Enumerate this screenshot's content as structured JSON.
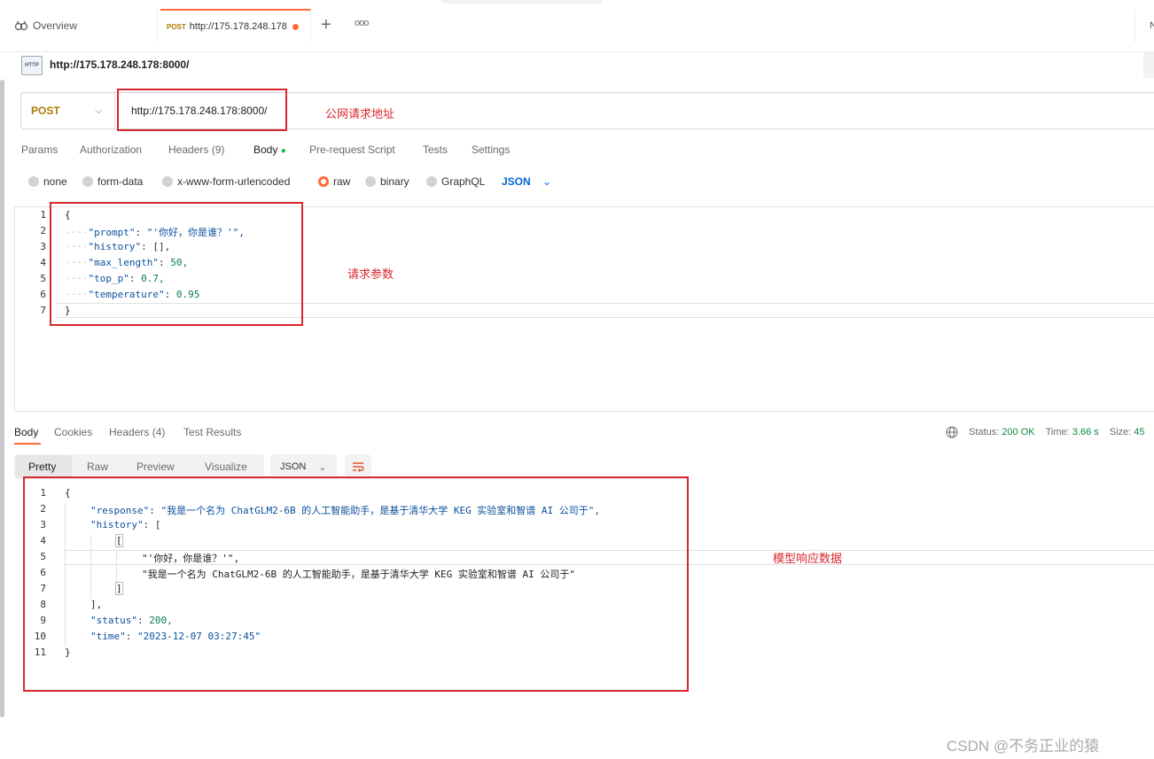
{
  "tabs": {
    "overview_label": "Overview",
    "active_method": "POST",
    "active_url": "http://175.178.248.178",
    "right_label": "N"
  },
  "request": {
    "title": "http://175.178.248.178:8000/",
    "http_icon": "HTTP",
    "method": "POST",
    "url": "http://175.178.248.178:8000/"
  },
  "request_tabs": [
    "Params",
    "Authorization",
    "Headers (9)",
    "Body",
    "Pre-request Script",
    "Tests",
    "Settings"
  ],
  "body_modes": [
    "none",
    "form-data",
    "x-www-form-urlencoded",
    "raw",
    "binary",
    "GraphQL"
  ],
  "body_format": "JSON",
  "request_body": {
    "line_numbers": [
      "1",
      "2",
      "3",
      "4",
      "5",
      "6",
      "7"
    ],
    "open": "{",
    "close": "}",
    "fields": [
      {
        "key": "\"prompt\"",
        "value": "\"'你好，你是谁？'\","
      },
      {
        "key": "\"history\"",
        "value": "[],"
      },
      {
        "key": "\"max_length\"",
        "value": "50,"
      },
      {
        "key": "\"top_p\"",
        "value": "0.7,"
      },
      {
        "key": "\"temperature\"",
        "value": "0.95"
      }
    ]
  },
  "response": {
    "tabs": [
      "Body",
      "Cookies",
      "Headers (4)",
      "Test Results"
    ],
    "status_label": "Status:",
    "status_value": "200 OK",
    "time_label": "Time:",
    "time_value": "3.66 s",
    "size_label": "Size:",
    "size_value": "45",
    "view_modes": [
      "Pretty",
      "Raw",
      "Preview",
      "Visualize"
    ],
    "format": "JSON",
    "line_numbers": [
      "1",
      "2",
      "3",
      "4",
      "5",
      "6",
      "7",
      "8",
      "9",
      "10",
      "11"
    ],
    "lines": [
      {
        "indent": 0,
        "text": "{"
      },
      {
        "indent": 1,
        "key": "\"response\"",
        "value": "\"我是一个名为 ChatGLM2-6B 的人工智能助手，是基于清华大学 KEG 实验室和智谱 AI 公司于\","
      },
      {
        "indent": 1,
        "key": "\"history\"",
        "value": "["
      },
      {
        "indent": 2,
        "text": "["
      },
      {
        "indent": 3,
        "value": "\"'你好，你是谁？'\","
      },
      {
        "indent": 3,
        "value": "\"我是一个名为 ChatGLM2-6B 的人工智能助手，是基于清华大学 KEG 实验室和智谱 AI 公司于\""
      },
      {
        "indent": 2,
        "text": "]"
      },
      {
        "indent": 1,
        "text": "],"
      },
      {
        "indent": 1,
        "key": "\"status\"",
        "value": "200,"
      },
      {
        "indent": 1,
        "key": "\"time\"",
        "value": "\"2023-12-07 03:27:45\""
      },
      {
        "indent": 0,
        "text": "}"
      }
    ]
  },
  "annotations": {
    "url_note": "公网请求地址",
    "params_note": "请求参数",
    "response_note": "模型响应数据"
  },
  "watermark": "CSDN @不务正业的猿",
  "colors": {
    "accent": "#ff6c37",
    "method": "#ad7a03",
    "annotation": "#d9272e",
    "json_link": "#0265d2",
    "status_ok": "#0b8a40"
  }
}
